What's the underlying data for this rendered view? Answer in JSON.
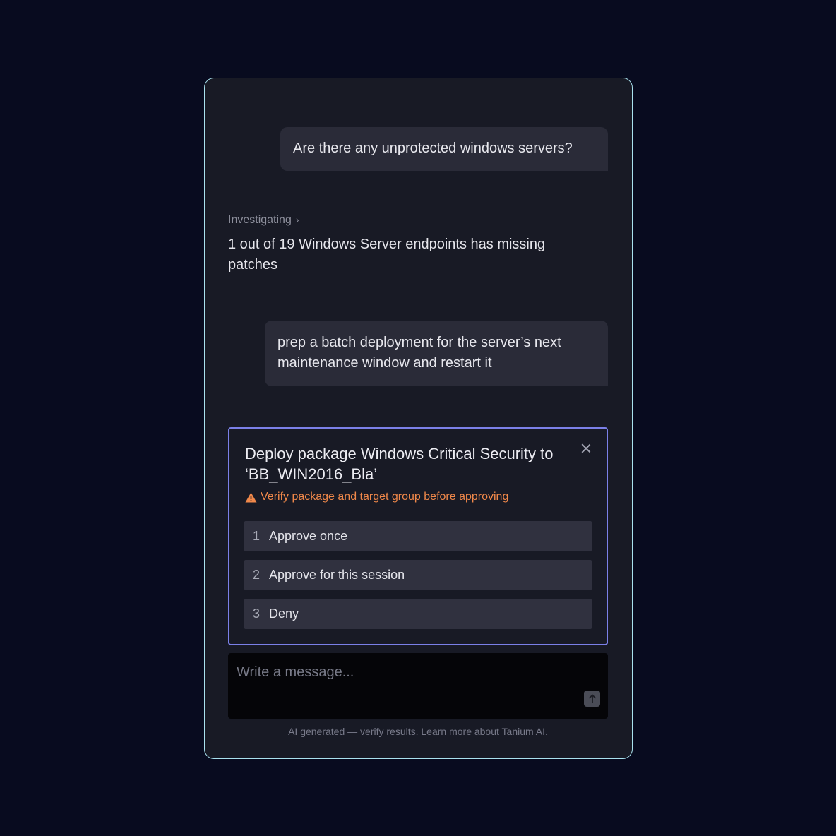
{
  "conversation": {
    "user_message_1": "Are there any unprotected windows servers?",
    "status_label": "Investigating",
    "status_chevron": "›",
    "assistant_reply": "1 out of 19 Windows Server endpoints has missing patches",
    "user_message_2": "prep a batch deployment for the server’s next maintenance window and restart it"
  },
  "approval": {
    "title": "Deploy package Windows Critical Security to ‘BB_WIN2016_Bla’",
    "warning": "Verify package and target group before approving",
    "warning_icon": "warning-triangle-icon",
    "close_icon": "close-icon",
    "options": [
      {
        "number": "1",
        "label": "Approve once"
      },
      {
        "number": "2",
        "label": "Approve for this session"
      },
      {
        "number": "3",
        "label": "Deny"
      }
    ]
  },
  "composer": {
    "placeholder": "Write a message...",
    "send_icon": "arrow-up-icon"
  },
  "footer": {
    "disclaimer": "AI generated — verify results. Learn more about Tanium AI."
  },
  "colors": {
    "background": "#080b1f",
    "panel": "#181a25",
    "panel_border": "#a9e1ee",
    "approval_border": "#7b80e8",
    "warning": "#f0884a"
  }
}
